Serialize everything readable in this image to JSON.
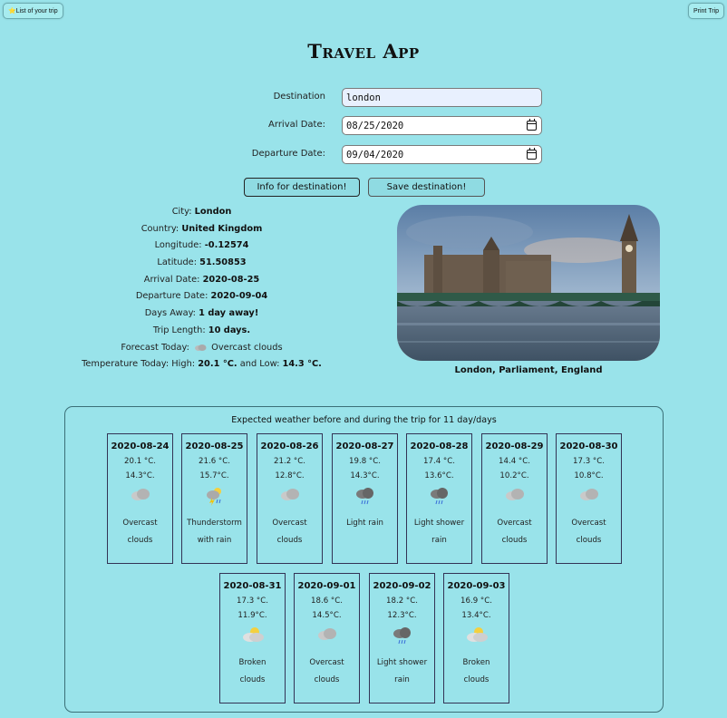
{
  "header": {
    "list_button": "⭐List of your trip",
    "print_button": "Print Trip",
    "title": "Travel App"
  },
  "form": {
    "destination_label": "Destination",
    "destination_value": "london",
    "arrival_label": "Arrival Date:",
    "arrival_value": "08/25/2020",
    "departure_label": "Departure Date:",
    "departure_value": "09/04/2020"
  },
  "buttons": {
    "info": "Info for destination!",
    "save": "Save destination!"
  },
  "info": {
    "city_label": "City:",
    "city": "London",
    "country_label": "Country:",
    "country": "United Kingdom",
    "longitude_label": "Longitude:",
    "longitude": "-0.12574",
    "latitude_label": "Latitude:",
    "latitude": "51.50853",
    "arrival_label": "Arrival Date:",
    "arrival": "2020-08-25",
    "departure_label": "Departure Date:",
    "departure": "2020-09-04",
    "days_away_label": "Days Away:",
    "days_away": "1 day away!",
    "trip_length_label": "Trip Length:",
    "trip_length": "10 days.",
    "forecast_label": "Forecast Today:",
    "forecast": "Overcast clouds",
    "temp_label": "Temperature Today: High:",
    "temp_high": "20.1 °C.",
    "temp_mid": "and Low:",
    "temp_low": "14.3 °C."
  },
  "photo": {
    "caption": "London, Parliament, England"
  },
  "weather": {
    "title": "Expected weather before and during the trip for 11 day/days",
    "days": [
      {
        "date": "2020-08-24",
        "high": "20.1 °C.",
        "low": "14.3°C.",
        "icon": "overcast-clouds-icon",
        "desc1": "Overcast",
        "desc2": "clouds"
      },
      {
        "date": "2020-08-25",
        "high": "21.6 °C.",
        "low": "15.7°C.",
        "icon": "thunderstorm-icon",
        "desc1": "Thunderstorm",
        "desc2": "with rain"
      },
      {
        "date": "2020-08-26",
        "high": "21.2 °C.",
        "low": "12.8°C.",
        "icon": "overcast-clouds-icon",
        "desc1": "Overcast",
        "desc2": "clouds"
      },
      {
        "date": "2020-08-27",
        "high": "19.8 °C.",
        "low": "14.3°C.",
        "icon": "light-rain-icon",
        "desc1": "Light rain",
        "desc2": ""
      },
      {
        "date": "2020-08-28",
        "high": "17.4 °C.",
        "low": "13.6°C.",
        "icon": "shower-rain-icon",
        "desc1": "Light shower",
        "desc2": "rain"
      },
      {
        "date": "2020-08-29",
        "high": "14.4 °C.",
        "low": "10.2°C.",
        "icon": "overcast-clouds-icon",
        "desc1": "Overcast",
        "desc2": "clouds"
      },
      {
        "date": "2020-08-30",
        "high": "17.3 °C.",
        "low": "10.8°C.",
        "icon": "overcast-clouds-icon",
        "desc1": "Overcast",
        "desc2": "clouds"
      },
      {
        "date": "2020-08-31",
        "high": "17.3 °C.",
        "low": "11.9°C.",
        "icon": "broken-clouds-icon",
        "desc1": "Broken",
        "desc2": "clouds"
      },
      {
        "date": "2020-09-01",
        "high": "18.6 °C.",
        "low": "14.5°C.",
        "icon": "overcast-clouds-icon",
        "desc1": "Overcast",
        "desc2": "clouds"
      },
      {
        "date": "2020-09-02",
        "high": "18.2 °C.",
        "low": "12.3°C.",
        "icon": "shower-rain-icon",
        "desc1": "Light shower",
        "desc2": "rain"
      },
      {
        "date": "2020-09-03",
        "high": "16.9 °C.",
        "low": "13.4°C.",
        "icon": "broken-clouds-icon",
        "desc1": "Broken",
        "desc2": "clouds"
      }
    ]
  }
}
